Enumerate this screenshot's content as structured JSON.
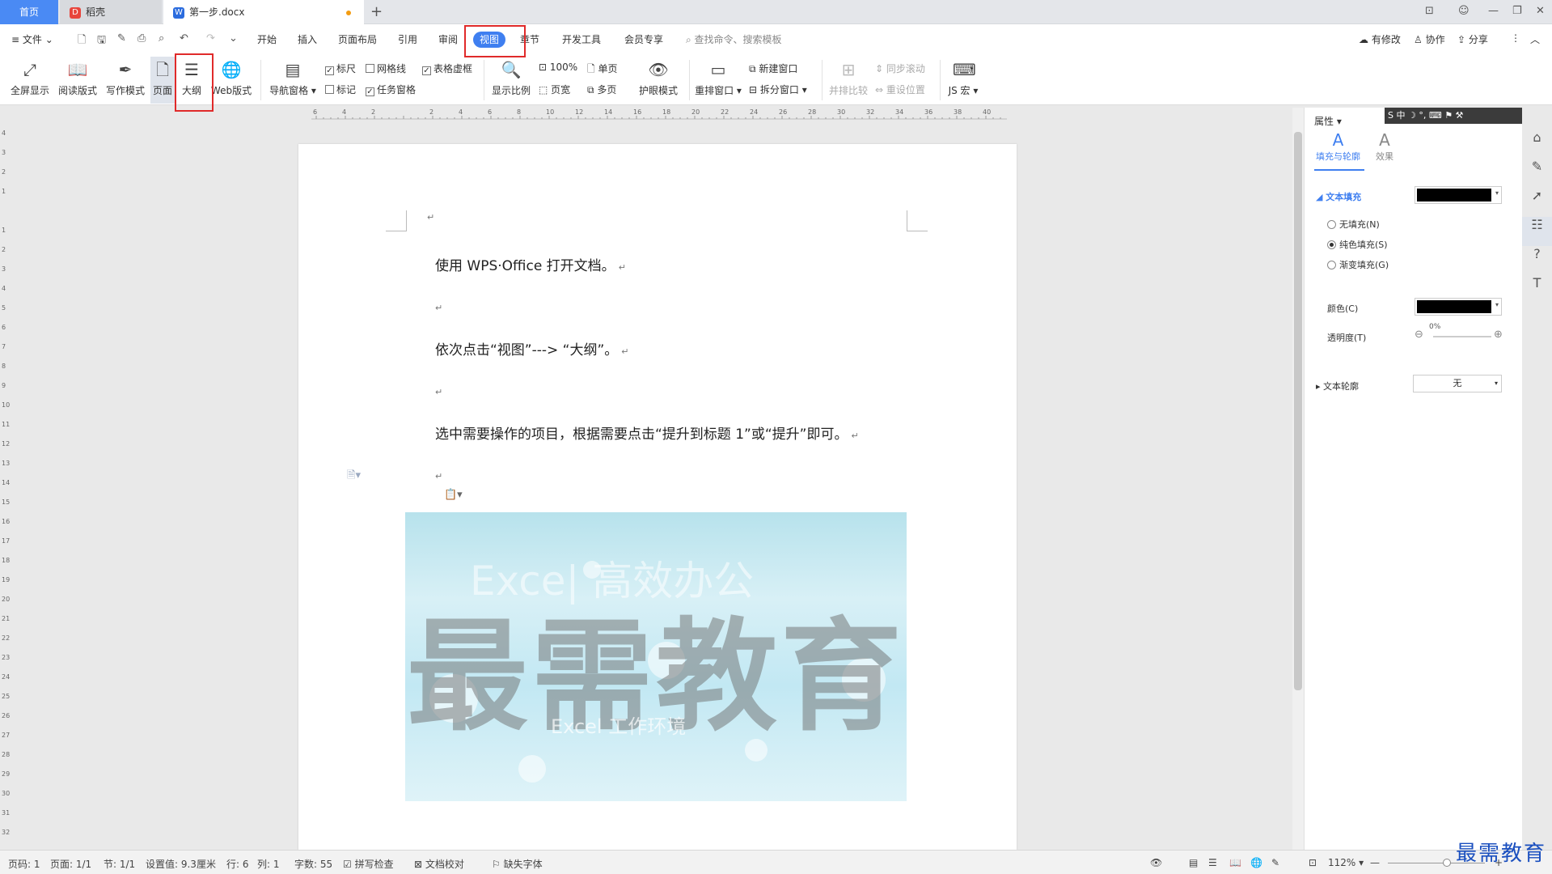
{
  "tabs": {
    "home": "首页",
    "daoke": "稻壳",
    "doc": "第一步.docx"
  },
  "menu": {
    "file": "文件",
    "items": [
      "开始",
      "插入",
      "页面布局",
      "引用",
      "审阅",
      "视图",
      "章节",
      "开发工具",
      "会员专享"
    ],
    "search": "查找命令、搜索模板",
    "right": [
      "有修改",
      "协作",
      "分享"
    ]
  },
  "ribbon": {
    "fullscreen": "全屏显示",
    "reading": "阅读版式",
    "writing": "写作模式",
    "page": "页面",
    "outline": "大纲",
    "web": "Web版式",
    "nav": "导航窗格",
    "ruler": "标尺",
    "gridlines": "网格线",
    "table_gridlines": "表格虚框",
    "marks": "标记",
    "task_pane": "任务窗格",
    "zoom_ratio": "显示比例",
    "zoom_100": "100%",
    "single_page": "单页",
    "page_width": "页宽",
    "multi_page": "多页",
    "eye_mode": "护眼模式",
    "rearrange": "重排窗口",
    "new_window": "新建窗口",
    "split_window": "拆分窗口",
    "side_by_side": "并排比较",
    "sync_scroll": "同步滚动",
    "reset_position": "重设位置",
    "js_macro": "JS 宏"
  },
  "ruler_numbers": [
    "6",
    "4",
    "2",
    "",
    "2",
    "4",
    "6",
    "8",
    "10",
    "12",
    "14",
    "16",
    "18",
    "20",
    "22",
    "24",
    "26",
    "28",
    "30",
    "32",
    "34",
    "36",
    "38",
    "40"
  ],
  "vruler_numbers": [
    "4",
    "3",
    "2",
    "1",
    "",
    "1",
    "2",
    "3",
    "4",
    "5",
    "6",
    "7",
    "8",
    "9",
    "10",
    "11",
    "12",
    "13",
    "14",
    "15",
    "16",
    "17",
    "18",
    "19",
    "20",
    "21",
    "22",
    "23",
    "24",
    "25",
    "26",
    "27",
    "28",
    "29",
    "30",
    "31",
    "32"
  ],
  "document": {
    "para1": "使用 WPS·Office 打开文档。",
    "para2": "依次点击“视图”---> “大纲”。",
    "para3": "选中需要操作的项目，根据需要点击“提升到标题 1”或“提升”即可。",
    "return_mark": "↵",
    "image_watermark": "最需教育",
    "image_top": "Exce| 高效办公",
    "image_sub": "Excel 工作环境"
  },
  "panel": {
    "title": "属性",
    "tab_fill": "填充与轮廓",
    "tab_effect": "效果",
    "text_fill": "文本填充",
    "no_fill": "无填充(N)",
    "solid_fill": "纯色填充(S)",
    "gradient_fill": "渐变填充(G)",
    "color": "颜色(C)",
    "transparency": "透明度(T)",
    "transparency_value": "0%",
    "text_outline": "文本轮廓",
    "outline_value": "无",
    "ime": "S 中 ☽ °, ⌨ ⚑ ⚒"
  },
  "status": {
    "page": "页码: 1",
    "pages": "页面: 1/1",
    "section": "节: 1/1",
    "setting": "设置值: 9.3厘米",
    "row": "行: 6",
    "col": "列: 1",
    "words": "字数: 55",
    "spell": "拼写检查",
    "proof": "文档校对",
    "missing_font": "缺失字体",
    "zoom": "112%"
  },
  "brand_watermark": "最需教育",
  "colors": {
    "accent": "#3f7ff0",
    "highlight": "#e02a2a"
  }
}
